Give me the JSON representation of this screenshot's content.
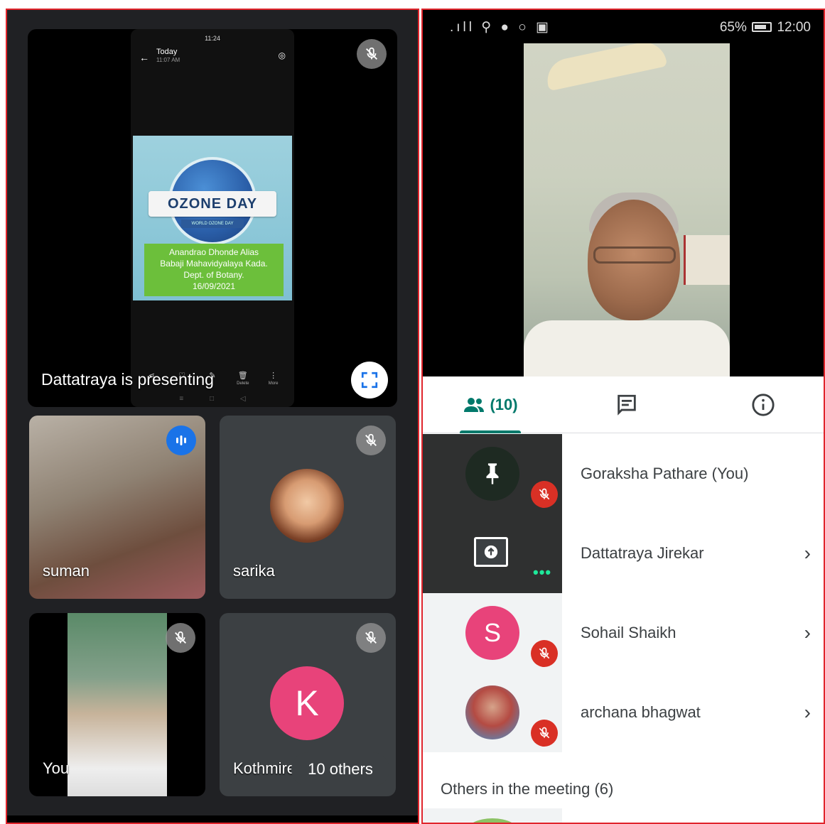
{
  "left": {
    "presentation": {
      "phone_status": "11:24",
      "phone_title": "Today",
      "phone_time": "11:07 AM",
      "poster_title": "OZONE DAY",
      "poster_subtitle": "WORLD OZONE DAY",
      "poster_caption": "Anandrao Dhonde Alias\nBabaji Mahavidyalaya Kada.\nDept. of Botany.\n16/09/2021",
      "actions": [
        {
          "icon": "share-icon",
          "label": ""
        },
        {
          "icon": "heart-icon",
          "label": ""
        },
        {
          "icon": "edit-icon",
          "label": ""
        },
        {
          "icon": "delete-icon",
          "label": "Delete"
        },
        {
          "icon": "more-icon",
          "label": "More"
        }
      ],
      "label": "Dattatraya is presenting"
    },
    "tiles": [
      {
        "name": "suman",
        "state": "speaking"
      },
      {
        "name": "sarika",
        "state": "muted"
      },
      {
        "name": "You",
        "state": "muted"
      },
      {
        "name": "Kothmire",
        "state": "muted",
        "avatar_letter": "K"
      }
    ],
    "others_label": "10 others"
  },
  "right": {
    "status": {
      "battery": "65%",
      "time": "12:00"
    },
    "tabs": {
      "people_count": "(10)",
      "chat_icon": "chat-icon",
      "info_icon": "info-icon"
    },
    "participants": [
      {
        "name": "Goraksha Pathare (You)",
        "thumb": "pin",
        "muted": true,
        "chevron": ""
      },
      {
        "name": "Dattatraya Jirekar",
        "thumb": "presenting",
        "muted": false,
        "chevron": "›"
      },
      {
        "name": "Sohail Shaikh",
        "thumb": "letter",
        "letter": "S",
        "muted": true,
        "chevron": "›"
      },
      {
        "name": "archana bhagwat",
        "thumb": "photo",
        "muted": true,
        "chevron": "›"
      }
    ],
    "others_section": "Others in the meeting (6)"
  },
  "colors": {
    "accent": "#00796b",
    "border": "#e0252c",
    "avatar_pink": "#e8437a",
    "mute_red": "#d93025",
    "speaking_blue": "#1a73e8"
  }
}
